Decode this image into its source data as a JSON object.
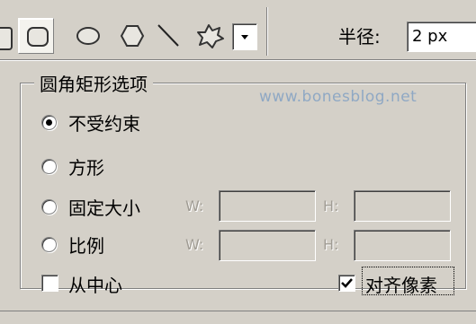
{
  "toolbar": {
    "tools": [
      {
        "name": "rounded-rectangle-tool",
        "selected": true
      },
      {
        "name": "ellipse-tool",
        "selected": false
      },
      {
        "name": "polygon-tool",
        "selected": false
      },
      {
        "name": "line-tool",
        "selected": false
      },
      {
        "name": "custom-shape-tool",
        "selected": false
      }
    ],
    "radius_label": "半径:",
    "radius_value": "2 px"
  },
  "options": {
    "group_title": "圆角矩形选项",
    "watermark": "www.bonesblog.net",
    "radio_options": [
      {
        "label": "不受约束",
        "checked": true
      },
      {
        "label": "方形",
        "checked": false
      },
      {
        "label": "固定大小",
        "checked": false
      },
      {
        "label": "比例",
        "checked": false
      }
    ],
    "width_label": "W:",
    "height_label": "H:",
    "from_center": {
      "label": "从中心",
      "checked": false
    },
    "snap_to_pixels": {
      "label": "对齐像素",
      "checked": true
    }
  },
  "colors": {
    "background": "#d4d0c8",
    "watermark": "#8fa8c4",
    "disabled_text": "#a09c94"
  }
}
